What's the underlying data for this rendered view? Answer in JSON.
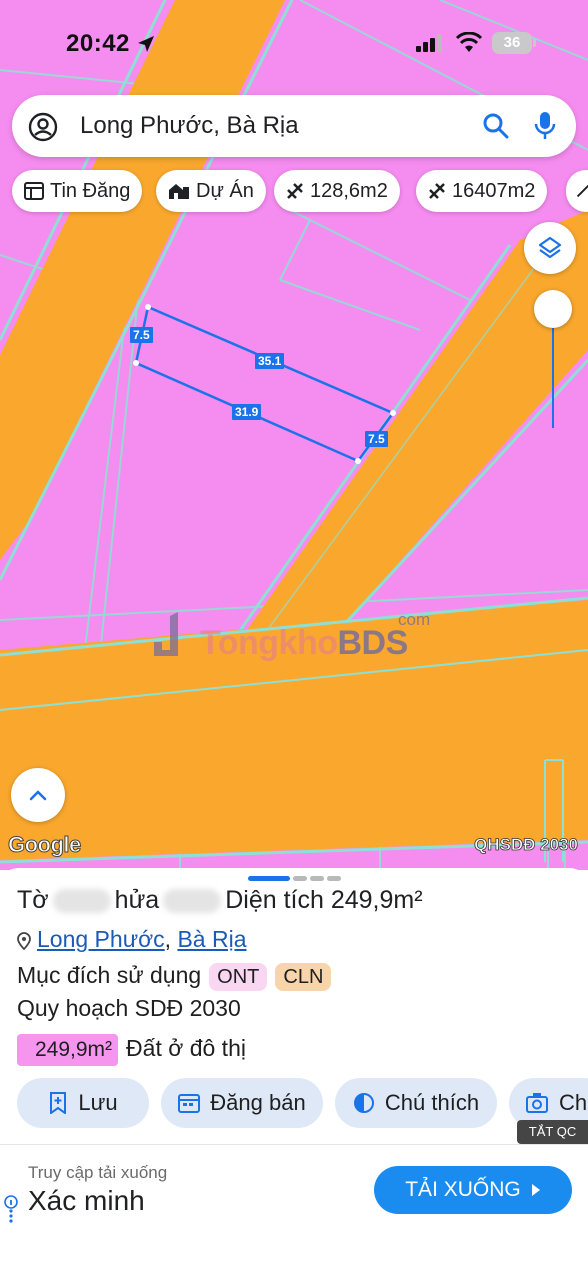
{
  "status_bar": {
    "time": "20:42",
    "battery": "36"
  },
  "search": {
    "query": "Long Phước, Bà Rịa"
  },
  "chips": [
    {
      "label": "Tin Đăng",
      "icon": "listing-icon"
    },
    {
      "label": "Dự Án",
      "icon": "building-icon"
    },
    {
      "label": "128,6m2",
      "icon": "measure-icon"
    },
    {
      "label": "16407m2",
      "icon": "measure-icon"
    }
  ],
  "map": {
    "plot_labels": {
      "left": "7.5",
      "top": "35.1",
      "bottom": "31.9",
      "right": "7.5"
    },
    "watermark": {
      "brand_a": "Tongkho",
      "brand_b": "BDS",
      "suffix": "com"
    },
    "google_logo": "Google",
    "layer_badge": "QHSDĐ 2030",
    "colors": {
      "residential": "#f58cf0",
      "road": "#f9a82d",
      "boundary": "#8fe0d4",
      "plot": "#1a73e8"
    }
  },
  "sheet": {
    "parcel": {
      "prefix_to": "Tờ",
      "prefix_thua": "hửa",
      "area_label": "Diện tích",
      "area_value": "249,9m²"
    },
    "location": {
      "commune": "Long Phước",
      "separator": ", ",
      "city": "Bà Rịa"
    },
    "usage_label": "Mục đích sử dụng",
    "usage_tags": [
      "ONT",
      "CLN"
    ],
    "plan_label": "Quy hoạch SDĐ 2030",
    "plan_area": "249,9m²",
    "plan_type": "Đất ở đô thị",
    "actions": [
      {
        "label": "Lưu",
        "icon": "bookmark-add-icon"
      },
      {
        "label": "Đăng bán",
        "icon": "calendar-icon"
      },
      {
        "label": "Chú thích",
        "icon": "contrast-icon"
      },
      {
        "label": "Ch",
        "icon": "camera-icon"
      }
    ]
  },
  "ad": {
    "close_label": "TẮT QC",
    "subtitle": "Truy cập tải xuống",
    "title": "Xác minh",
    "cta": "TẢI XUỐNG"
  }
}
